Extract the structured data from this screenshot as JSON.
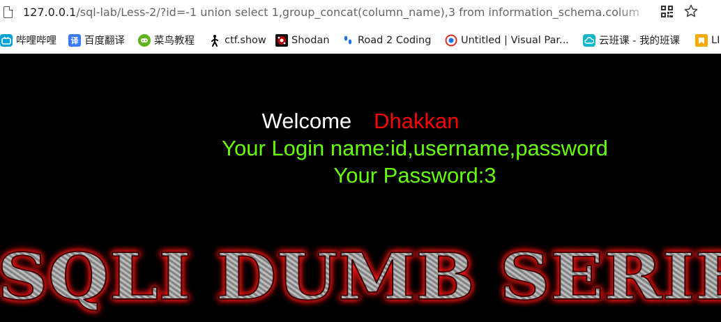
{
  "browser": {
    "url_host": "127.0.0.1",
    "url_path": "/sql-lab/Less-2/?id=-1 union select 1,group_concat(column_name),3 from information_schema.colum",
    "icons": [
      "page-icon",
      "qr-code-icon",
      "bookmark-star-icon"
    ]
  },
  "bookmarks": [
    {
      "label": "哔哩哔哩",
      "icon": "bilibili-icon",
      "color": "#00a1d6"
    },
    {
      "label": "百度翻译",
      "icon": "translate-icon",
      "color": "#3b7cff"
    },
    {
      "label": "菜鸟教程",
      "icon": "runoob-icon",
      "color": "#5fb41c"
    },
    {
      "label": "ctf.show",
      "icon": "ctfshow-icon",
      "color": "#000000"
    },
    {
      "label": "Shodan",
      "icon": "shodan-icon",
      "color": "#b80000"
    },
    {
      "label": "Road 2 Coding",
      "icon": "footprints-icon",
      "color": "#1a73e8"
    },
    {
      "label": "Untitled | Visual Par...",
      "icon": "visual-paradigm-icon",
      "color": "#d93025"
    },
    {
      "label": "云班课 - 我的班课",
      "icon": "cloud-class-icon",
      "color": "#10b7c8"
    },
    {
      "label": "LI",
      "icon": "folder-icon",
      "color": "#f9ab00"
    }
  ],
  "page": {
    "welcome": "Welcome",
    "name": "Dhakkan",
    "login_line": "Your Login name:id,username,password",
    "password_line": "Your Password:3",
    "banner_text": "SQLI DUMB SERIES",
    "colors": {
      "background": "#000000",
      "name": "#ff0000",
      "result": "#66ff00",
      "banner_glow": "#ff0000"
    }
  }
}
